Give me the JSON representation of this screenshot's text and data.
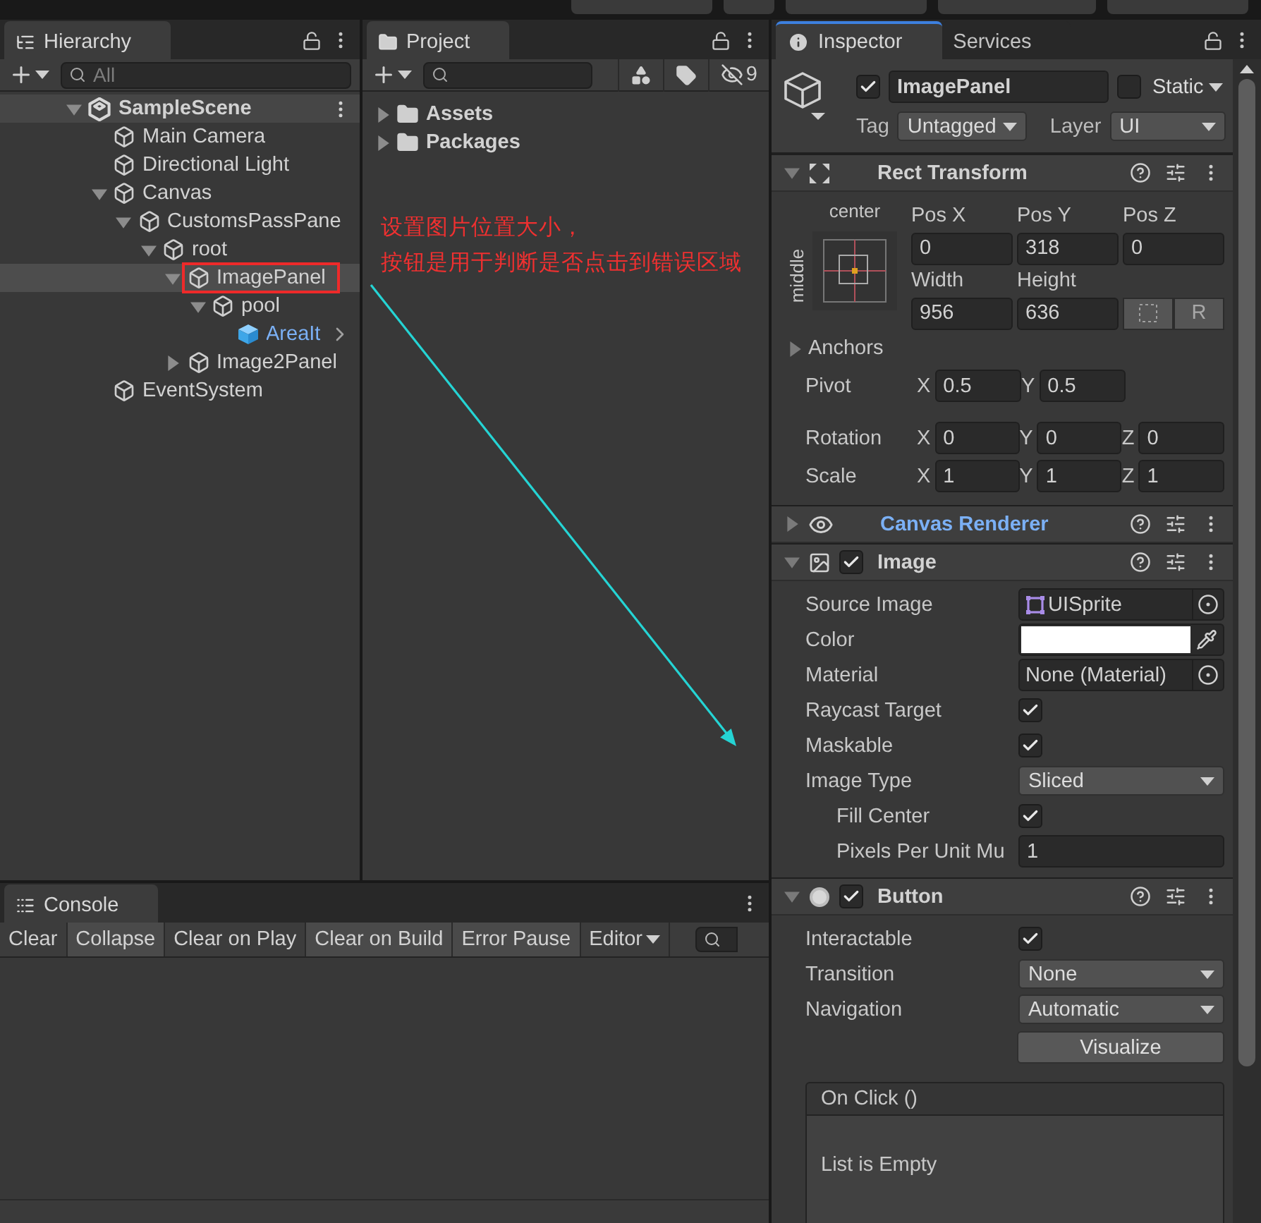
{
  "hierarchy": {
    "tab": {
      "label": "Hierarchy",
      "selected": true
    },
    "search_placeholder": "All",
    "scene": {
      "label": "SampleScene",
      "expanded": true,
      "children": [
        {
          "label": "Main Camera",
          "kind": "object",
          "selected": false
        },
        {
          "label": "Directional Light",
          "kind": "object",
          "selected": false
        },
        {
          "label": "Canvas",
          "kind": "object",
          "selected": false,
          "expanded": true,
          "children": [
            {
              "label": "CustomsPassPane",
              "kind": "object",
              "selected": false,
              "expanded": true,
              "children": [
                {
                  "label": "root",
                  "kind": "object",
                  "selected": false,
                  "expanded": true,
                  "children": [
                    {
                      "label": "ImagePanel",
                      "kind": "object",
                      "selected": true,
                      "highlighted": true,
                      "expanded": true,
                      "children": [
                        {
                          "label": "pool",
                          "kind": "object",
                          "selected": false,
                          "expanded": true,
                          "children": [
                            {
                              "label": "AreaIt",
                              "kind": "prefab",
                              "selected": false
                            }
                          ]
                        }
                      ]
                    },
                    {
                      "label": "Image2Panel",
                      "kind": "object",
                      "selected": false,
                      "expanded": false
                    }
                  ]
                }
              ]
            }
          ]
        },
        {
          "label": "EventSystem",
          "kind": "object",
          "selected": false
        }
      ]
    }
  },
  "project": {
    "tab": {
      "label": "Project",
      "selected": true
    },
    "hidden_count": "9",
    "items": [
      {
        "label": "Assets",
        "expanded": false
      },
      {
        "label": "Packages",
        "expanded": false
      }
    ]
  },
  "annotation": {
    "lines": [
      "设置图片位置大小，",
      "按钮是用于判断是否点击到错误区域"
    ]
  },
  "console": {
    "tab": {
      "label": "Console",
      "selected": true
    },
    "buttons": [
      {
        "kind": "button",
        "label": "Clear"
      },
      {
        "kind": "toggle",
        "label": "Collapse",
        "on": true
      },
      {
        "kind": "toggle",
        "label": "Clear on Play",
        "on": false
      },
      {
        "kind": "toggle",
        "label": "Clear on Build",
        "on": true
      },
      {
        "kind": "toggle",
        "label": "Error Pause",
        "on": true
      },
      {
        "kind": "dropdown",
        "label": "Editor"
      }
    ]
  },
  "inspector": {
    "tabs": [
      {
        "label": "Inspector",
        "selected": true
      },
      {
        "label": "Services",
        "selected": false
      }
    ],
    "object": {
      "active": true,
      "name": "ImagePanel",
      "static": false,
      "static_label": "Static",
      "tag_label": "Tag",
      "tag": "Untagged",
      "layer_label": "Layer",
      "layer": "UI"
    },
    "components": [
      {
        "kind": "rect_transform",
        "title": "Rect Transform",
        "color": "#d2d2d2",
        "expanded": true,
        "anchor_h": "center",
        "anchor_v": "middle",
        "fields": [
          {
            "label": "Pos X",
            "value": "0"
          },
          {
            "label": "Pos Y",
            "value": "318"
          },
          {
            "label": "Pos Z",
            "value": "0"
          },
          {
            "label": "Width",
            "value": "956"
          },
          {
            "label": "Height",
            "value": "636"
          }
        ],
        "raw_label": "R",
        "anchors": {
          "label": "Anchors",
          "expanded": false
        },
        "vectors": [
          {
            "label": "Pivot",
            "axes": [
              {
                "axis": "X",
                "value": "0.5"
              },
              {
                "axis": "Y",
                "value": "0.5"
              }
            ]
          },
          {
            "label": "Rotation",
            "axes": [
              {
                "axis": "X",
                "value": "0"
              },
              {
                "axis": "Y",
                "value": "0"
              },
              {
                "axis": "Z",
                "value": "0"
              }
            ]
          },
          {
            "label": "Scale",
            "axes": [
              {
                "axis": "X",
                "value": "1"
              },
              {
                "axis": "Y",
                "value": "1"
              },
              {
                "axis": "Z",
                "value": "1"
              }
            ]
          }
        ]
      },
      {
        "kind": "canvas_renderer",
        "title": "Canvas Renderer",
        "color": "#7bb0f5",
        "expanded": false
      },
      {
        "kind": "image",
        "title": "Image",
        "color": "#d2d2d2",
        "expanded": true,
        "enabled": true,
        "properties": [
          {
            "kind": "sprite",
            "label": "Source Image",
            "value": "UISprite"
          },
          {
            "kind": "color",
            "label": "Color",
            "color": "#ffffff"
          },
          {
            "kind": "object",
            "label": "Material",
            "value": "None (Material)"
          },
          {
            "kind": "checkbox",
            "label": "Raycast Target",
            "checked": true
          },
          {
            "kind": "checkbox",
            "label": "Maskable",
            "checked": true
          },
          {
            "kind": "dropdown",
            "label": "Image Type",
            "value": "Sliced",
            "children": [
              {
                "kind": "checkbox",
                "label": "Fill Center",
                "checked": true
              },
              {
                "kind": "number",
                "label": "Pixels Per Unit Mu",
                "value": "1"
              }
            ]
          }
        ]
      },
      {
        "kind": "button",
        "title": "Button",
        "color": "#d2d2d2",
        "expanded": true,
        "enabled": true,
        "properties": [
          {
            "kind": "checkbox",
            "label": "Interactable",
            "checked": true
          },
          {
            "kind": "dropdown",
            "label": "Transition",
            "value": "None"
          },
          {
            "kind": "dropdown",
            "label": "Navigation",
            "value": "Automatic"
          }
        ],
        "action": "Visualize",
        "event": {
          "title": "On Click ()",
          "empty_text": "List is Empty"
        }
      }
    ]
  }
}
